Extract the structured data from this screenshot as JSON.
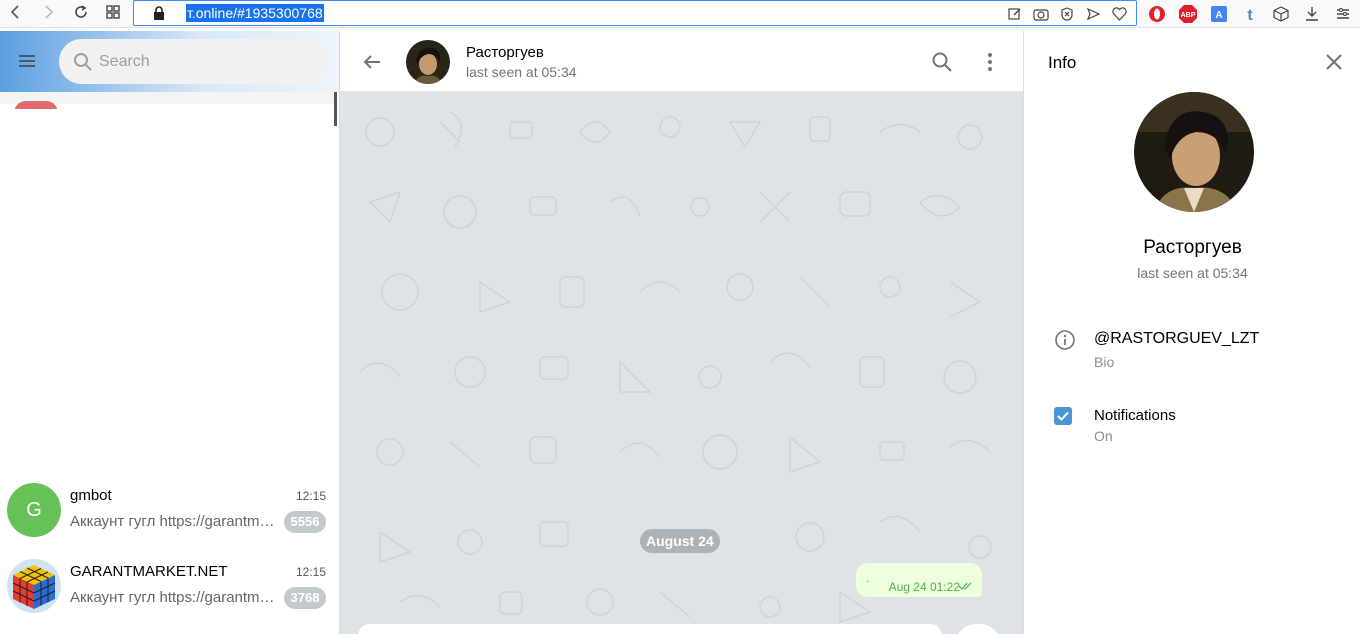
{
  "browser": {
    "url_display": "т.online/#1935300768",
    "colors": {
      "selection": "#1a73e8",
      "url_border": "#3b8ef0"
    }
  },
  "sidebar": {
    "search_placeholder": "Search",
    "chats": [
      {
        "name": "gmbot",
        "time": "12:15",
        "preview": "Аккаунт гугл https://garantm…",
        "unread": "5556",
        "avatar_letter": "G",
        "avatar_color": "#66c257"
      },
      {
        "name": "GARANTMARKET.NET",
        "time": "12:15",
        "preview": "Аккаунт гугл https://garantm…",
        "unread": "3768",
        "avatar_icon": "rubiks-cube-icon"
      }
    ]
  },
  "chat": {
    "peer_name": "Расторгуев",
    "peer_status": "last seen at 05:34",
    "date_separator": "August 24",
    "messages": [
      {
        "text": ".",
        "time": "Aug 24 01:22",
        "status": "read",
        "outgoing": true
      }
    ],
    "colors": {
      "background": "#dfe3e6",
      "outgoing_bubble": "#eeffde",
      "meta_green": "#4fae4e"
    }
  },
  "info": {
    "title": "Info",
    "name": "Расторгуев",
    "status": "last seen at 05:34",
    "username": "@RASTORGUEV_LZT",
    "username_label": "Bio",
    "notifications_label": "Notifications",
    "notifications_value": "On",
    "notifications_enabled": true
  }
}
